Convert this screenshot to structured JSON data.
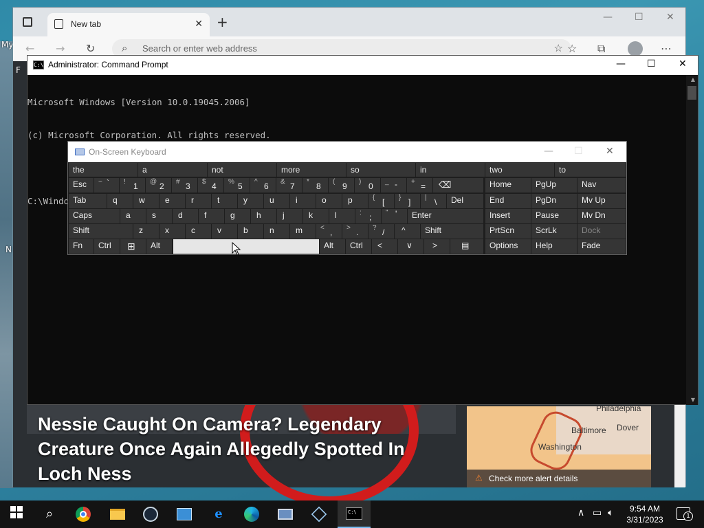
{
  "desktop": {
    "label_my": "My",
    "label_n": "N"
  },
  "edge": {
    "tab_title": "New tab",
    "tab_close": "✕",
    "new_tab": "+",
    "address_placeholder": "Search or enter web address",
    "win_min": "—",
    "win_max": "☐",
    "win_close": "✕",
    "news_headline": "Nessie Caught On Camera? Legendary Creature Once Again Allegedly Spotted In Loch Ness",
    "map_labels": {
      "philadelphia": "Philadelphia",
      "baltimore": "Baltimore",
      "dover": "Dover",
      "washington": "Washington"
    },
    "alert_text": "Check more alert details"
  },
  "cmd": {
    "title": "Administrator: Command Prompt",
    "icon_text": "C:\\",
    "lines": [
      "Microsoft Windows [Version 10.0.19045.2006]",
      "(c) Microsoft Corporation. All rights reserved.",
      "",
      "C:\\Windows\\system32>localuser Administrator "
    ],
    "btn_min": "—",
    "btn_max": "☐",
    "btn_close": "✕"
  },
  "osk": {
    "title": "On-Screen Keyboard",
    "btn_min": "—",
    "btn_max": "☐",
    "btn_close": "✕",
    "predictions": [
      "the",
      "a",
      "not",
      "more",
      "so",
      "in",
      "two",
      "to"
    ],
    "row1": {
      "esc": "Esc",
      "tilde_sup": "~",
      "tilde": "`",
      "k1s": "!",
      "k1": "1",
      "k2s": "@",
      "k2": "2",
      "k3s": "#",
      "k3": "3",
      "k4s": "$",
      "k4": "4",
      "k5s": "%",
      "k5": "5",
      "k6s": "^",
      "k6": "6",
      "k7s": "&",
      "k7": "7",
      "k8s": "*",
      "k8": "8",
      "k9s": "(",
      "k9": "9",
      "k0s": ")",
      "k0": "0",
      "minus_s": "_",
      "minus": "-",
      "plus_s": "+",
      "plus": "=",
      "backspace": "⌫",
      "home": "Home",
      "pgup": "PgUp",
      "nav": "Nav"
    },
    "row2": {
      "tab": "Tab",
      "q": "q",
      "w": "w",
      "e": "e",
      "r": "r",
      "t": "t",
      "y": "y",
      "u": "u",
      "i": "i",
      "o": "o",
      "p": "p",
      "lb_s": "{",
      "lb": "[",
      "rb_s": "}",
      "rb": "]",
      "bs_s": "|",
      "bs": "\\",
      "del": "Del",
      "end": "End",
      "pgdn": "PgDn",
      "mvup": "Mv Up"
    },
    "row3": {
      "caps": "Caps",
      "a": "a",
      "s": "s",
      "d": "d",
      "f": "f",
      "g": "g",
      "h": "h",
      "j": "j",
      "k": "k",
      "l": "l",
      "sc_s": ":",
      "sc": ";",
      "q_s": "\"",
      "q": "'",
      "enter": "Enter",
      "insert": "Insert",
      "pause": "Pause",
      "mvdn": "Mv Dn"
    },
    "row4": {
      "shift": "Shift",
      "z": "z",
      "x": "x",
      "c": "c",
      "v": "v",
      "b": "b",
      "n": "n",
      "m": "m",
      "lt_s": "<",
      "lt": ",",
      "gt_s": ">",
      "gt": ".",
      "qm_s": "?",
      "qm": "/",
      "up": "^",
      "shift_r": "Shift",
      "prtscn": "PrtScn",
      "scrlk": "ScrLk",
      "dock": "Dock"
    },
    "row5": {
      "fn": "Fn",
      "ctrl": "Ctrl",
      "win": "⊞",
      "alt": "Alt",
      "alt_r": "Alt",
      "ctrl_r": "Ctrl",
      "left": "<",
      "down": "∨",
      "right": ">",
      "menu": "▤",
      "options": "Options",
      "help": "Help",
      "fade": "Fade"
    }
  },
  "taskbar": {
    "time": "9:54 AM",
    "date": "3/31/2023",
    "notif_count": "1"
  }
}
